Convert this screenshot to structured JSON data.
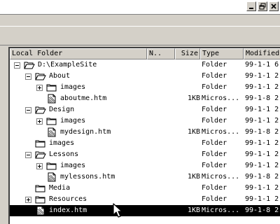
{
  "window": {
    "minimize_icon": "minimize-icon",
    "restore_icon": "restore-icon",
    "close_icon": "close-icon"
  },
  "columns": {
    "local_folder": "Local Folder",
    "notes": "N..",
    "size": "Size",
    "type": "Type",
    "modified": "Modified"
  },
  "rows": [
    {
      "name": "D:\\ExampleSite",
      "size": "",
      "type": "Folder",
      "modified": "99-1-1 6",
      "icon": "folder-open-icon",
      "level": 0,
      "expander": "minus"
    },
    {
      "name": "About",
      "size": "",
      "type": "Folder",
      "modified": "99-1-1 2",
      "icon": "folder-open-icon",
      "level": 1,
      "expander": "minus"
    },
    {
      "name": "images",
      "size": "",
      "type": "Folder",
      "modified": "99-1-1 2",
      "icon": "folder-icon",
      "level": 2,
      "expander": "plus"
    },
    {
      "name": "aboutme.htm",
      "size": "1KB",
      "type": "Micros...",
      "modified": "99-1-8 2",
      "icon": "html-file-icon",
      "level": 2,
      "expander": "none"
    },
    {
      "name": "Design",
      "size": "",
      "type": "Folder",
      "modified": "99-1-1 2",
      "icon": "folder-open-icon",
      "level": 1,
      "expander": "minus"
    },
    {
      "name": "images",
      "size": "",
      "type": "Folder",
      "modified": "99-1-1 2",
      "icon": "folder-icon",
      "level": 2,
      "expander": "plus"
    },
    {
      "name": "mydesign.htm",
      "size": "1KB",
      "type": "Micros...",
      "modified": "99-1-8 2",
      "icon": "html-file-icon",
      "level": 2,
      "expander": "none"
    },
    {
      "name": "images",
      "size": "",
      "type": "Folder",
      "modified": "99-1-1 2",
      "icon": "folder-icon",
      "level": 1,
      "expander": "none"
    },
    {
      "name": "Lessons",
      "size": "",
      "type": "Folder",
      "modified": "99-1-1 2",
      "icon": "folder-open-icon",
      "level": 1,
      "expander": "minus"
    },
    {
      "name": "images",
      "size": "",
      "type": "Folder",
      "modified": "99-1-1 2",
      "icon": "folder-icon",
      "level": 2,
      "expander": "plus"
    },
    {
      "name": "mylessons.htm",
      "size": "1KB",
      "type": "Micros...",
      "modified": "99-1-8 2",
      "icon": "html-file-icon",
      "level": 2,
      "expander": "none"
    },
    {
      "name": "Media",
      "size": "",
      "type": "Folder",
      "modified": "99-1-1 2",
      "icon": "folder-icon",
      "level": 1,
      "expander": "none"
    },
    {
      "name": "Resources",
      "size": "",
      "type": "Folder",
      "modified": "99-1-1 2",
      "icon": "folder-icon",
      "level": 1,
      "expander": "plus"
    },
    {
      "name": "index.htm",
      "size": "1KB",
      "type": "Micros...",
      "modified": "99-1-8 2",
      "icon": "html-file-icon",
      "level": 1,
      "expander": "none",
      "selected": true
    }
  ],
  "colors": {
    "selection": "#000000",
    "folder": "#ffffff",
    "chrome": "#d4d0c8"
  }
}
